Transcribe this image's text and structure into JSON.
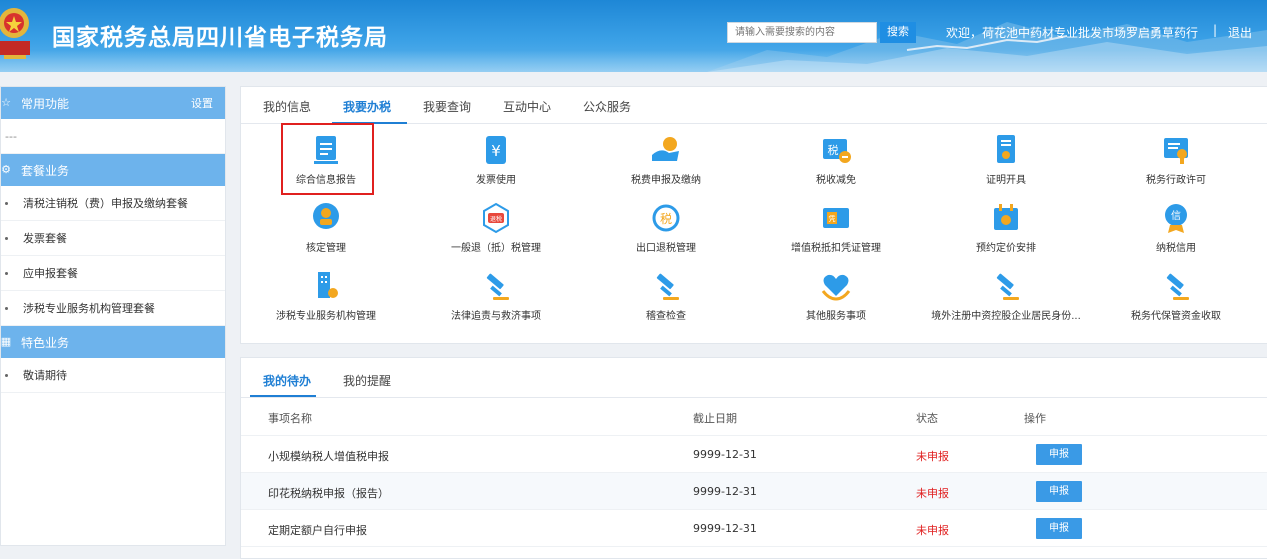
{
  "header": {
    "title": "国家税务总局四川省电子税务局",
    "search_placeholder": "请输入需要搜索的内容",
    "search_button": "搜索",
    "welcome": "欢迎，荷花池中药材专业批发市场罗启勇草药行",
    "separator": "|",
    "logout": "退出",
    "brand_color": "#1e87d6"
  },
  "sidebar": {
    "common": {
      "title": "常用功能",
      "setting": "设置",
      "placeholder": "---"
    },
    "package": {
      "title": "套餐业务",
      "items": [
        "清税注销税（费）申报及缴纳套餐",
        "发票套餐",
        "应申报套餐",
        "涉税专业服务机构管理套餐"
      ]
    },
    "special": {
      "title": "特色业务",
      "items": [
        "敬请期待"
      ]
    }
  },
  "main": {
    "tabs": [
      "我的信息",
      "我要办税",
      "我要查询",
      "互动中心",
      "公众服务"
    ],
    "active_tab": "我要办税",
    "functions": [
      {
        "label": "综合信息报告",
        "icon": "report-icon"
      },
      {
        "label": "发票使用",
        "icon": "invoice-icon"
      },
      {
        "label": "税费申报及缴纳",
        "icon": "pay-icon"
      },
      {
        "label": "税收减免",
        "icon": "tax-reduce-icon"
      },
      {
        "label": "证明开具",
        "icon": "certificate-icon"
      },
      {
        "label": "税务行政许可",
        "icon": "license-icon"
      },
      {
        "label": "核定管理",
        "icon": "approve-icon"
      },
      {
        "label": "一般退（抵）税管理",
        "icon": "refund-icon"
      },
      {
        "label": "出口退税管理",
        "icon": "export-refund-icon"
      },
      {
        "label": "增值税抵扣凭证管理",
        "icon": "voucher-icon"
      },
      {
        "label": "预约定价安排",
        "icon": "calendar-icon"
      },
      {
        "label": "纳税信用",
        "icon": "credit-icon"
      },
      {
        "label": "涉税专业服务机构管理",
        "icon": "building-icon"
      },
      {
        "label": "法律追责与救济事项",
        "icon": "gavel-icon"
      },
      {
        "label": "稽查检查",
        "icon": "gavel-icon"
      },
      {
        "label": "其他服务事项",
        "icon": "heart-icon"
      },
      {
        "label": "境外注册中资控股企业居民身份...",
        "icon": "gavel-icon"
      },
      {
        "label": "税务代保管资金收取",
        "icon": "gavel-icon"
      }
    ]
  },
  "todo": {
    "tabs": [
      "我的待办",
      "我的提醒"
    ],
    "columns": [
      "事项名称",
      "截止日期",
      "状态",
      "操作"
    ],
    "rows": [
      {
        "name": "小规模纳税人增值税申报",
        "date": "9999-12-31",
        "status": "未申报",
        "action": "申报"
      },
      {
        "name": "印花税纳税申报（报告）",
        "date": "9999-12-31",
        "status": "未申报",
        "action": "申报"
      },
      {
        "name": "定期定额户自行申报",
        "date": "9999-12-31",
        "status": "未申报",
        "action": "申报"
      }
    ]
  }
}
